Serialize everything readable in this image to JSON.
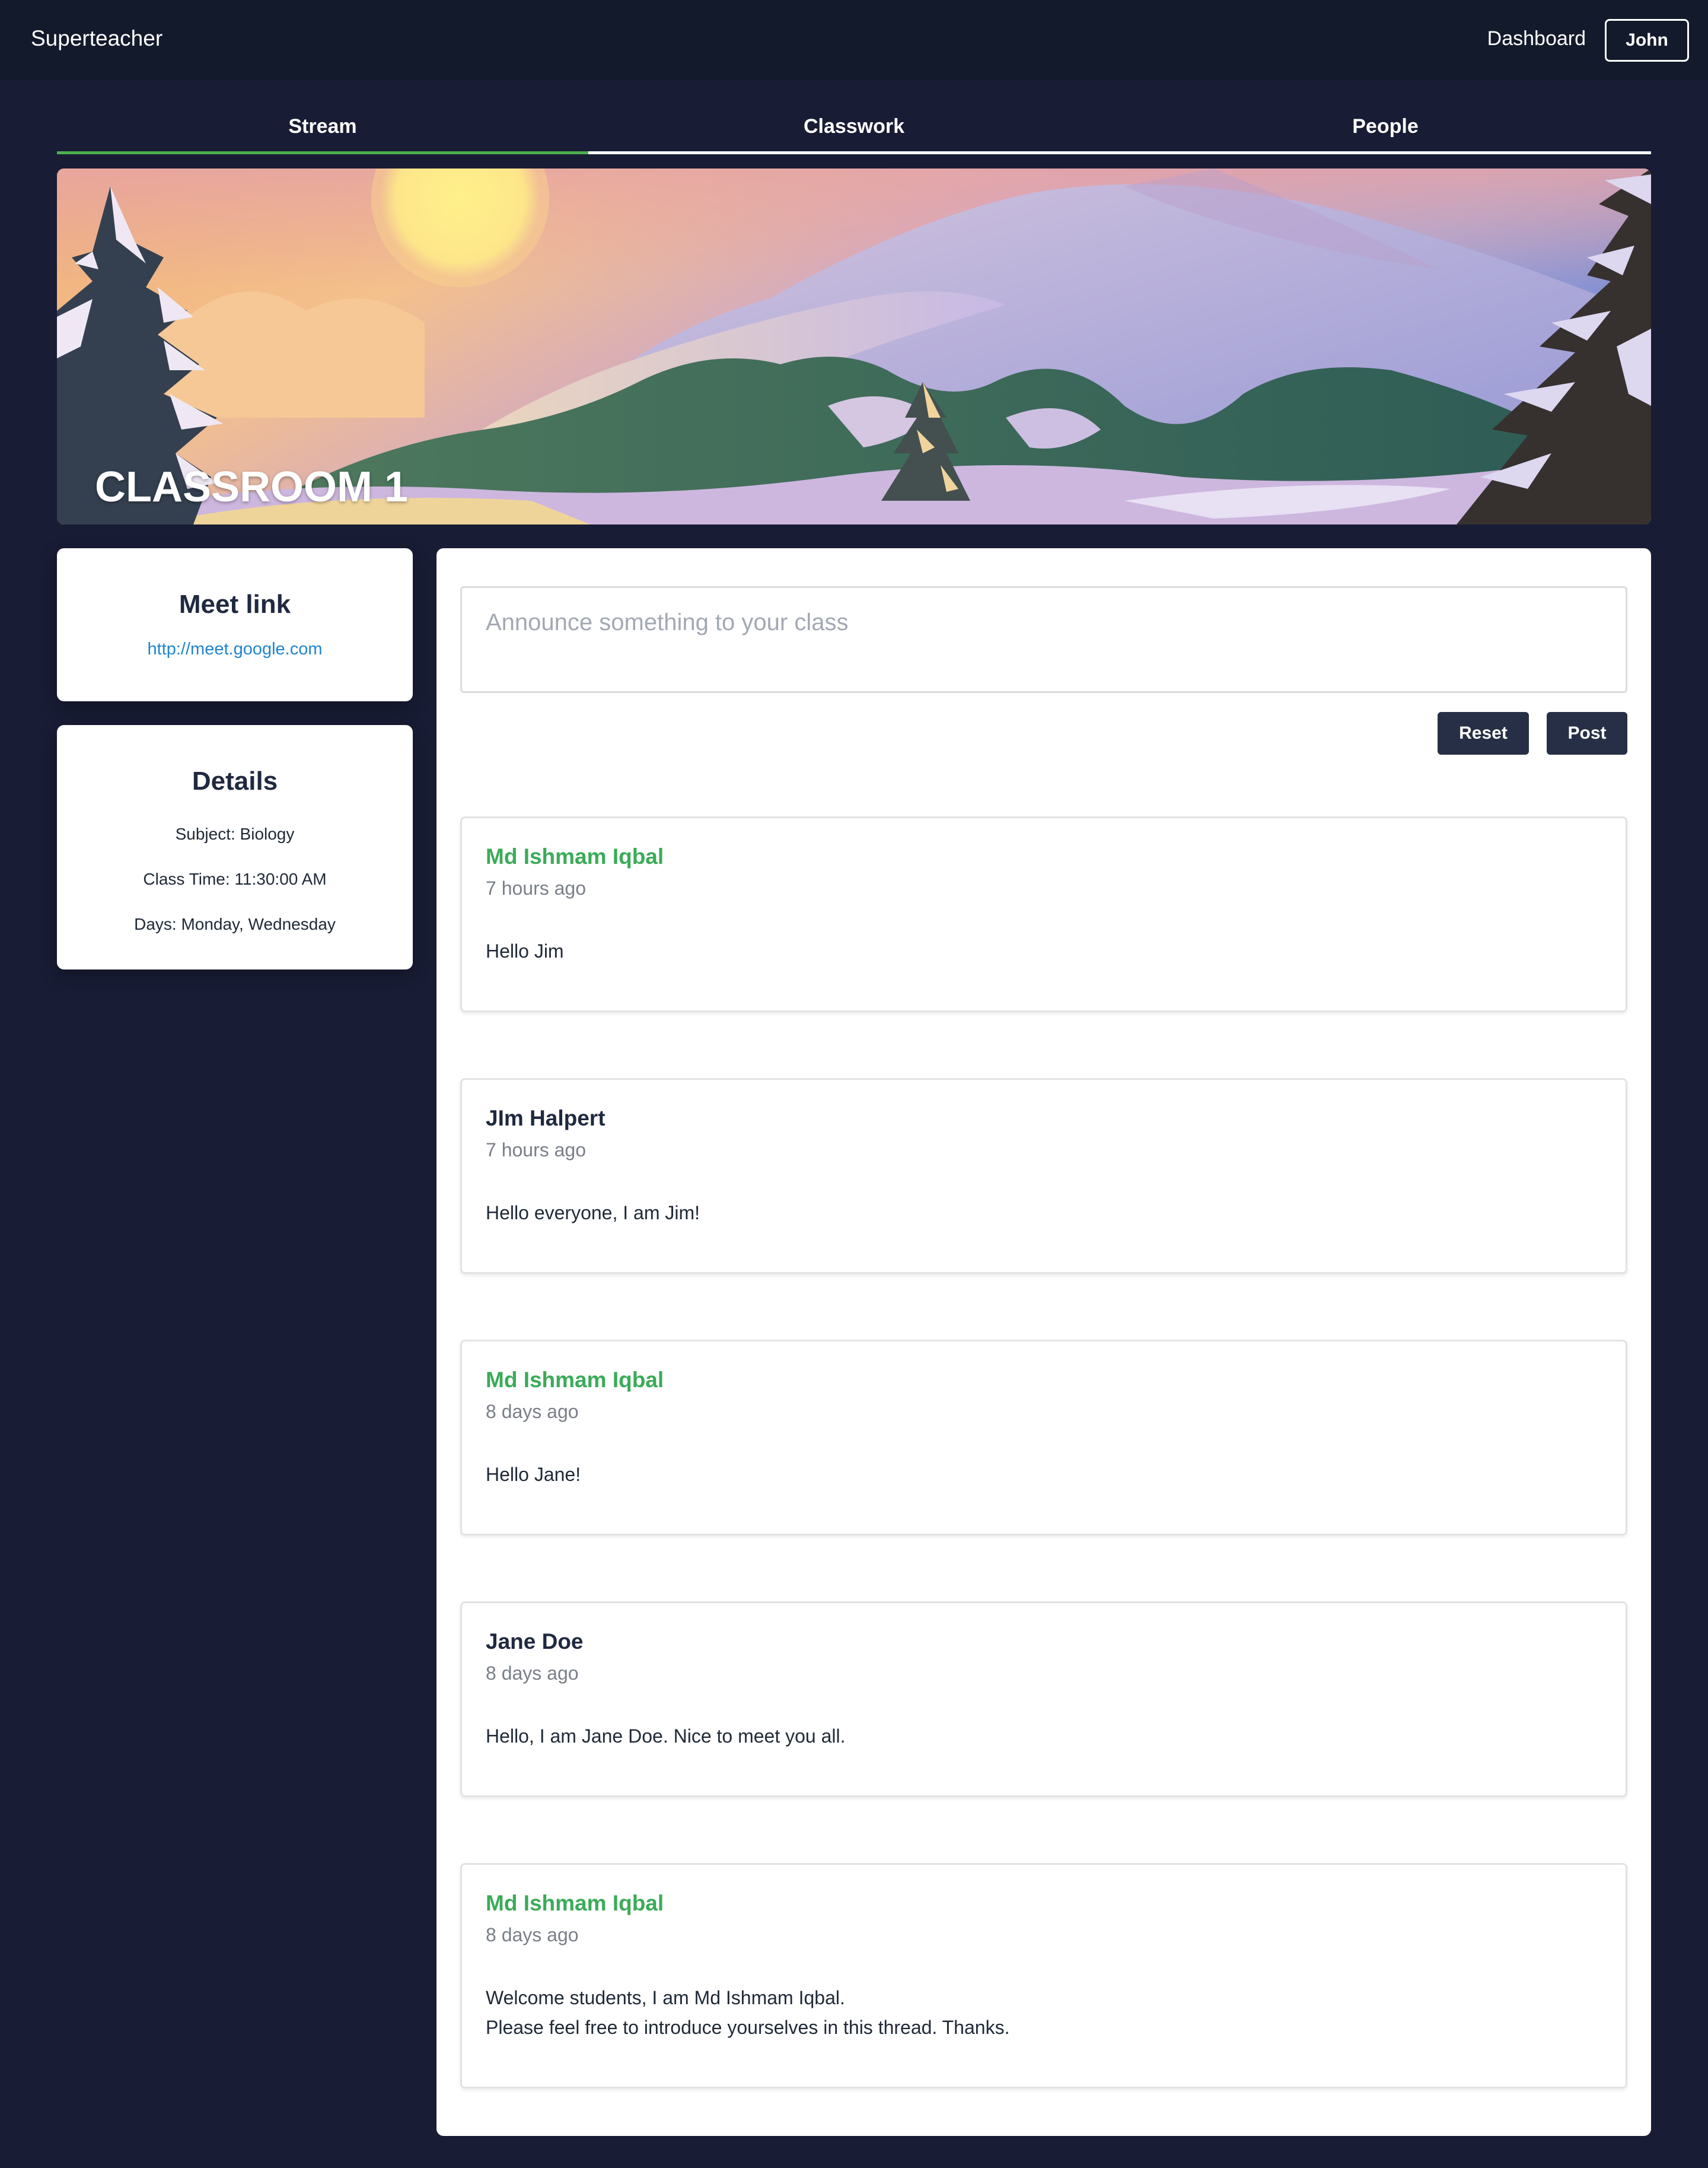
{
  "header": {
    "brand": "Superteacher",
    "dashboard_link": "Dashboard",
    "user_button": "John"
  },
  "tabs": [
    {
      "label": "Stream",
      "active": true
    },
    {
      "label": "Classwork",
      "active": false
    },
    {
      "label": "People",
      "active": false
    }
  ],
  "banner": {
    "title": "CLASSROOM 1"
  },
  "meet": {
    "heading": "Meet link",
    "link": "http://meet.google.com"
  },
  "details": {
    "heading": "Details",
    "subject": "Subject: Biology",
    "class_time": "Class Time: 11:30:00 AM",
    "days": "Days: Monday, Wednesday"
  },
  "composer": {
    "placeholder": "Announce something to your class",
    "reset_label": "Reset",
    "post_label": "Post"
  },
  "posts": [
    {
      "author": "Md Ishmam Iqbal",
      "time": "7 hours ago",
      "lines": [
        "Hello Jim"
      ],
      "highlight": true
    },
    {
      "author": "JIm Halpert",
      "time": "7 hours ago",
      "lines": [
        "Hello everyone, I am Jim!"
      ],
      "highlight": false
    },
    {
      "author": "Md Ishmam Iqbal",
      "time": "8 days ago",
      "lines": [
        "Hello Jane!"
      ],
      "highlight": true
    },
    {
      "author": "Jane Doe",
      "time": "8 days ago",
      "lines": [
        "Hello, I am Jane Doe. Nice to meet you all."
      ],
      "highlight": false
    },
    {
      "author": "Md Ishmam Iqbal",
      "time": "8 days ago",
      "lines": [
        "Welcome students, I am Md Ishmam Iqbal.",
        "Please feel free to introduce yourselves in this thread. Thanks."
      ],
      "highlight": true
    }
  ],
  "colors": {
    "background": "#181c34",
    "topbar": "#131a2b",
    "accent_green": "#3bab58",
    "link_blue": "#2185d0",
    "button_dark": "#262f45"
  }
}
